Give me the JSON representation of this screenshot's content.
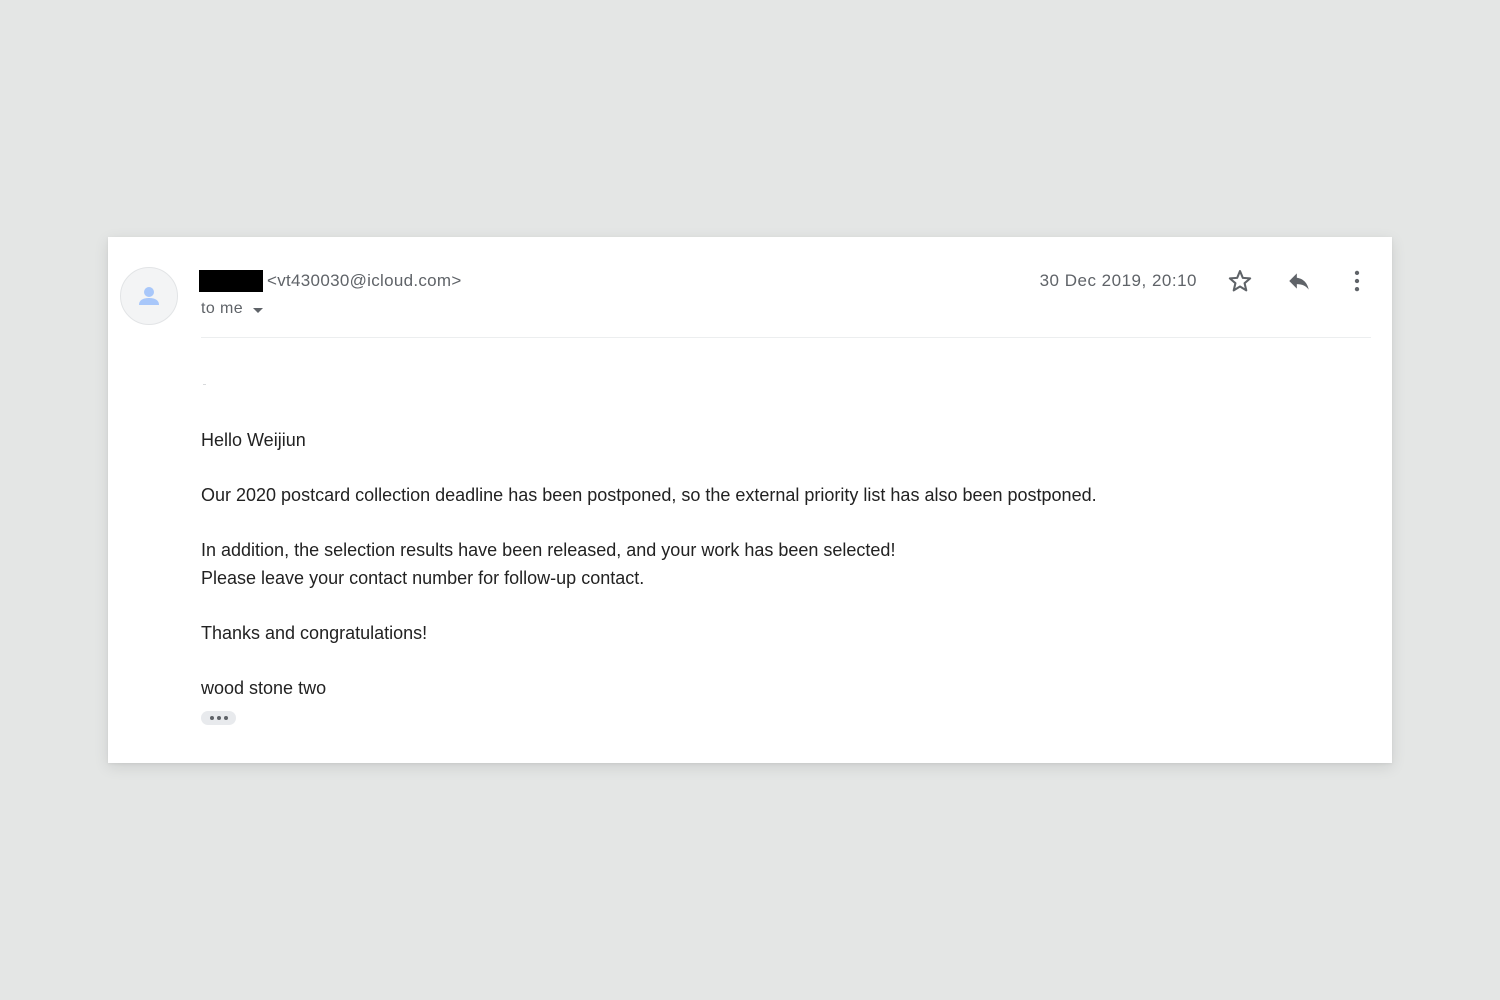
{
  "email": {
    "sender_email": "<vt430030@icloud.com>",
    "recipient_label": "to me",
    "timestamp": "30 Dec 2019, 20:10",
    "body": {
      "greeting": "Hello Weijiun",
      "paragraph1": "Our 2020 postcard collection deadline has been postponed, so the external priority list has also been postponed.",
      "paragraph2_line1": "In addition, the selection results have been released, and your work has been selected!",
      "paragraph2_line2": "Please leave your contact number for follow-up contact.",
      "closing": "Thanks and congratulations!",
      "signature": "wood stone two"
    }
  },
  "icons": {
    "avatar": "person-icon",
    "star": "star-outline-icon",
    "reply": "reply-icon",
    "more": "more-vertical-icon",
    "expand": "ellipsis-icon",
    "recipient_toggle": "caret-down-icon"
  },
  "colors": {
    "page_background": "#e4e6e5",
    "card_background": "#ffffff",
    "avatar_accent": "#a8c7fa",
    "secondary_text": "#5f6368",
    "body_text": "#222222"
  }
}
